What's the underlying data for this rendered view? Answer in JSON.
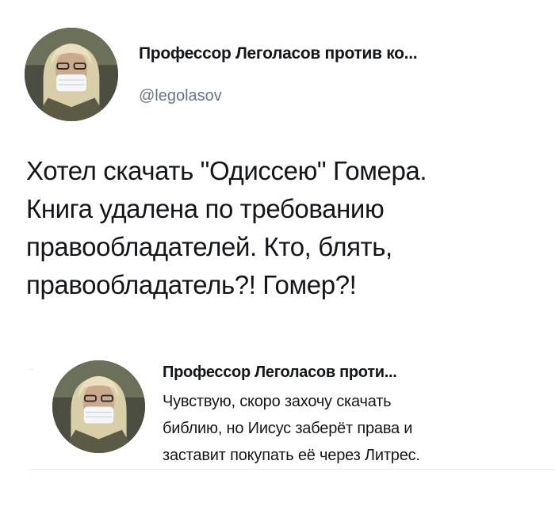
{
  "tweet": {
    "author_name": "Профессор Леголасов против ко...",
    "author_handle": "@legolasov",
    "text": "Хотел скачать \"Одиссею\" Гомера.\nКнига удалена по требованию\nправообладателей. Кто, блять,\nправообладатель?! Гомер?!"
  },
  "reply": {
    "author_name": "Профессор Леголасов проти...",
    "text": "Чувствую, скоро захочу скачать\nбиблию, но Иисус заберёт права и\nзаставит покупать её через Литрес."
  }
}
